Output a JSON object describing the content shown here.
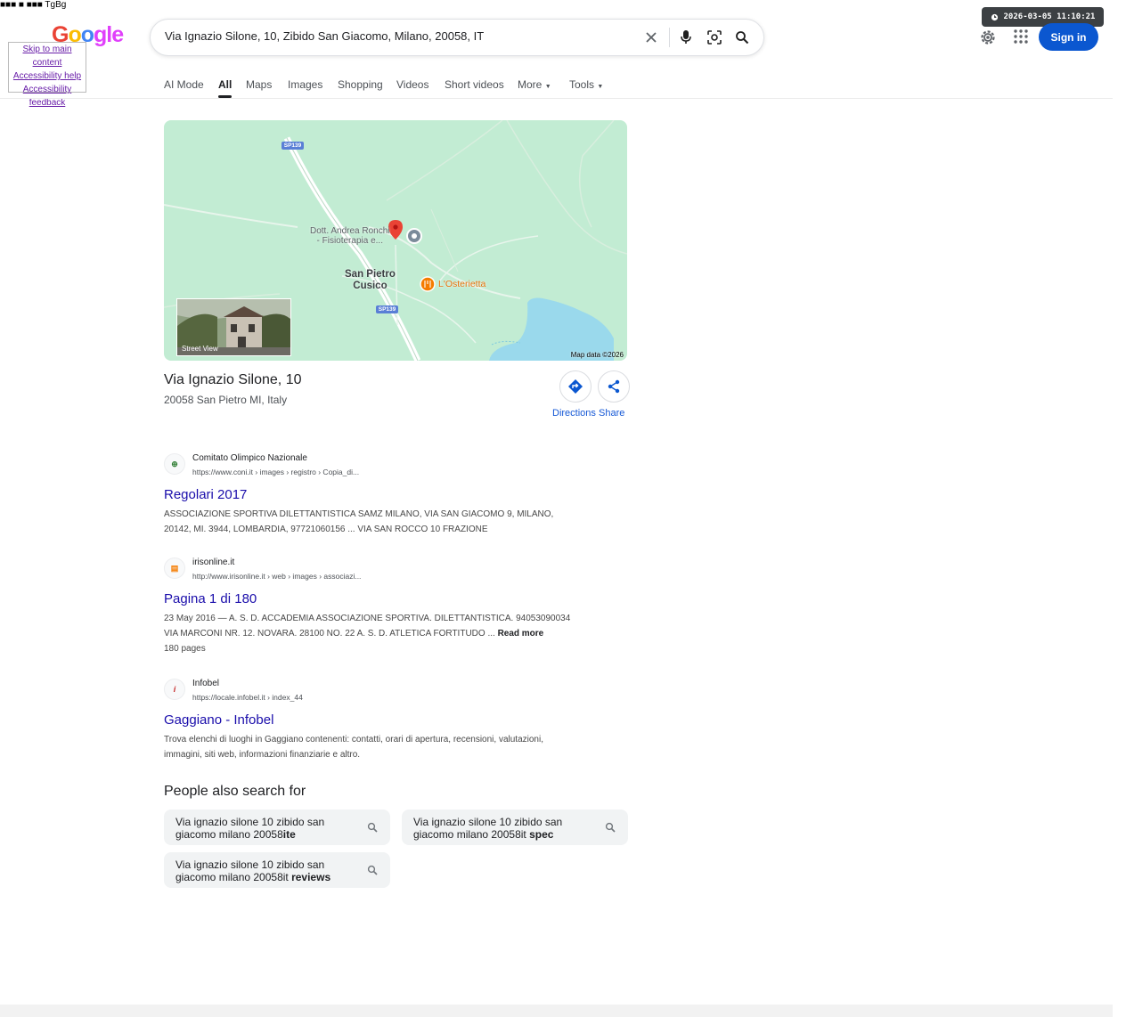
{
  "overlay": {
    "top_left_text": "■■■ ■ ■■■ TgBg",
    "skip_links": [
      "Skip to main content",
      "Accessibility help",
      "Accessibility feedback"
    ]
  },
  "logo": {
    "letters": [
      "G",
      "o",
      "o",
      "g",
      "l",
      "e"
    ],
    "colors": [
      "#ea4335",
      "#fbbc05",
      "#4285f4",
      "#e040fb",
      "#e040fb",
      "#e040fb"
    ]
  },
  "search": {
    "query": "Via Ignazio Silone, 10, Zibido San Giacomo, Milano, 20058, IT",
    "icons": [
      "close-icon",
      "mic-icon",
      "lens-icon",
      "search-icon"
    ]
  },
  "header": {
    "timestamp": "2026-03-05 11:10:21",
    "signin_label": "Sign in"
  },
  "tabs": [
    {
      "label": "AI Mode",
      "active": false
    },
    {
      "label": "All",
      "active": true
    },
    {
      "label": "Maps",
      "active": false
    },
    {
      "label": "Images",
      "active": false
    },
    {
      "label": "Shopping",
      "active": false
    },
    {
      "label": "Videos",
      "active": false
    },
    {
      "label": "Short videos",
      "active": false
    },
    {
      "label": "More",
      "active": false
    },
    {
      "label": "Tools",
      "active": false
    }
  ],
  "map": {
    "road_labels": [
      "SP139",
      "SP139"
    ],
    "poi_1": "Dott. Andrea Ronchi - Fisioterapia e...",
    "poi_1_lines": [
      "Dott. Andrea Ronchi",
      "- Fisioterapia e..."
    ],
    "town_lines": [
      "San Pietro",
      "Cusico"
    ],
    "poi_2": "L'Osterietta",
    "street_view_label": "Street View",
    "credit": "Map data ©2026",
    "colors": {
      "land": "#c2ecd3",
      "water": "#9ad9ec",
      "road": "#ffffff",
      "pin": "#ea4335",
      "poi_orange": "#f57c00"
    }
  },
  "place": {
    "title": "Via Ignazio Silone, 10",
    "subtitle": "20058 San Pietro MI, Italy",
    "directions_label": "Directions",
    "share_label": "Share"
  },
  "results": [
    {
      "site": "Comitato Olimpico Nazionale",
      "url": "https://www.coni.it › images › registro › Copia_di...",
      "title": "Regolari 2017",
      "snippet_lines": [
        "ASSOCIAZIONE SPORTIVA DILETTANTISTICA SAMZ MILANO, VIA SAN GIACOMO 9, MILANO,",
        "20142, MI. 3944, LOMBARDIA, 97721060156 ... VIA SAN ROCCO 10 FRAZIONE"
      ]
    },
    {
      "site": "irisonline.it",
      "url": "http://www.irisonline.it › web › images › associazi...",
      "title": "Pagina 1 di 180",
      "snippet_lines": [
        "23 May 2016 — A. S. D. ACCADEMIA ASSOCIAZIONE SPORTIVA. DILETTANTISTICA. 94053090034",
        "VIA MARCONI NR. 12. NOVARA. 28100 NO. 22 A. S. D. ATLETICA FORTITUDO ...",
        "180 pages"
      ],
      "read_more": "Read more"
    },
    {
      "site": "Infobel",
      "url": "https://locale.infobel.it › index_44",
      "title": "Gaggiano - Infobel",
      "snippet_lines": [
        "Trova elenchi di luoghi in Gaggiano contenenti: contatti, orari di apertura, recensioni, valutazioni,",
        "immagini, siti web, informazioni finanziarie e altro."
      ]
    }
  ],
  "people_also_search": {
    "heading": "People also search for",
    "items": [
      {
        "line1": "Via ignazio silone 10 zibido san",
        "line2_prefix": "giacomo milano 20058",
        "line2_bold": "ite"
      },
      {
        "line1": "Via ignazio silone 10 zibido san",
        "line2_prefix": "giacomo milano 20058it ",
        "line2_bold": "spec"
      },
      {
        "line1": "Via ignazio silone 10 zibido san",
        "line2_prefix": "giacomo milano 20058it ",
        "line2_bold": "reviews"
      }
    ]
  }
}
